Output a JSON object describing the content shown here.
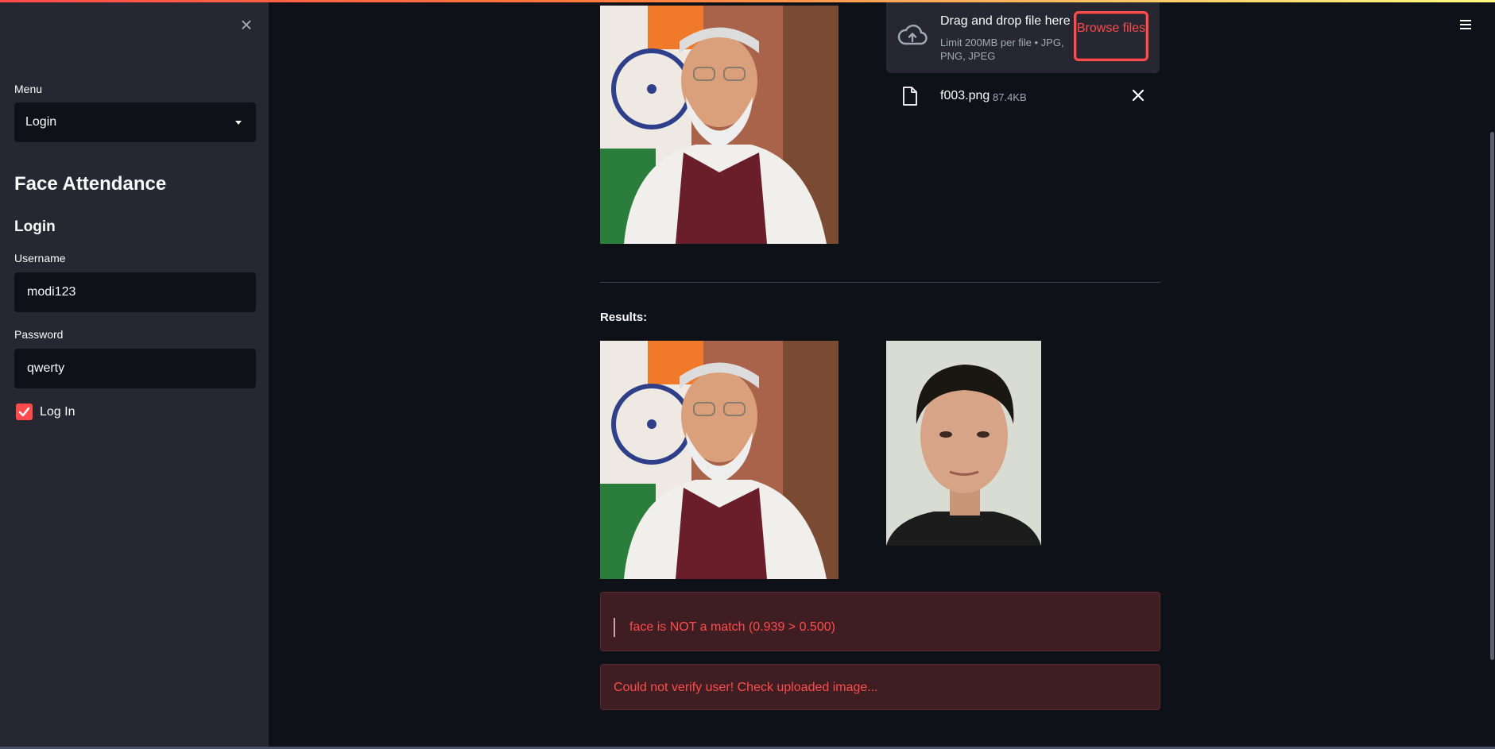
{
  "sidebar": {
    "menu_label": "Menu",
    "menu_value": "Login",
    "title": "Face Attendance",
    "subtitle": "Login",
    "username_label": "Username",
    "username_value": "modi123",
    "password_label": "Password",
    "password_value": "qwerty",
    "checkbox_label": "Log In",
    "checkbox_checked": true
  },
  "uploader": {
    "drag_text": "Drag and drop file here",
    "limit_text": "Limit 200MB per file • JPG, PNG, JPEG",
    "browse_label": "Browse files",
    "file_name": "f003.png",
    "file_size": "87.4KB"
  },
  "results": {
    "label": "Results:",
    "match_message": "face is NOT a match (0.939 > 0.500)",
    "error_message": "Could not verify user! Check uploaded image..."
  },
  "colors": {
    "background": "#0e1117",
    "sidebar": "#262730",
    "accent": "#ff4b4b",
    "error_bg": "#3e1e22"
  },
  "icons": [
    "close-icon",
    "chevron-down-icon",
    "check-icon",
    "cloud-upload-icon",
    "file-icon",
    "remove-file-icon",
    "hamburger-menu-icon"
  ]
}
